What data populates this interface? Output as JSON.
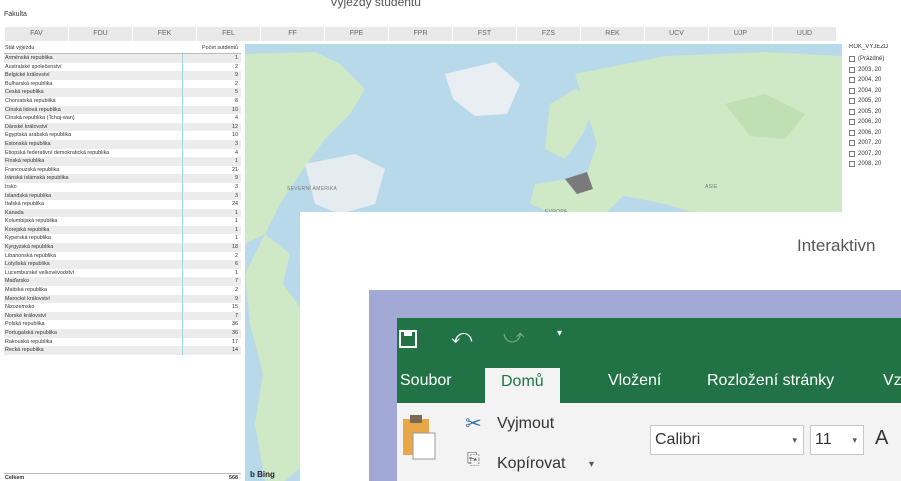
{
  "report": {
    "faculty_label": "Fakulta",
    "faculties": [
      "FAV",
      "FDU",
      "FEK",
      "FEL",
      "FF",
      "FPE",
      "FPR",
      "FST",
      "FZS",
      "REK",
      "UCV",
      "UJP",
      "UUD"
    ]
  },
  "table": {
    "col_country": "Stát výjezdu",
    "col_count": "Počet sutdentů",
    "rows": [
      {
        "name": "Arménská republika",
        "value": "1"
      },
      {
        "name": "Australské společenství",
        "value": "2"
      },
      {
        "name": "Belgické království",
        "value": "9"
      },
      {
        "name": "Bulharská republika",
        "value": "2"
      },
      {
        "name": "Česká republika",
        "value": "5"
      },
      {
        "name": "Chorvatská republika",
        "value": "8"
      },
      {
        "name": "Čínská lidová republika",
        "value": "10"
      },
      {
        "name": "Čínská republika (Tchaj-wan)",
        "value": "4"
      },
      {
        "name": "Dánské království",
        "value": "12"
      },
      {
        "name": "Egyptská arabská republika",
        "value": "10"
      },
      {
        "name": "Estonská republika",
        "value": "3"
      },
      {
        "name": "Etiopská federativní demokratická republika",
        "value": "4"
      },
      {
        "name": "Finská republika",
        "value": "1"
      },
      {
        "name": "Francouzská republika",
        "value": "21"
      },
      {
        "name": "Íránská islámská republika",
        "value": "9"
      },
      {
        "name": "Irsko",
        "value": "3"
      },
      {
        "name": "Islandská republika",
        "value": "3"
      },
      {
        "name": "Italská republika",
        "value": "24"
      },
      {
        "name": "Kanada",
        "value": "1"
      },
      {
        "name": "Kolumbijská republika",
        "value": "1"
      },
      {
        "name": "Korejská republika",
        "value": "1"
      },
      {
        "name": "Kyperská republika",
        "value": "1"
      },
      {
        "name": "Kyrgyzská republika",
        "value": "18"
      },
      {
        "name": "Libanonská republika",
        "value": "2"
      },
      {
        "name": "Lotyšská republika",
        "value": "6"
      },
      {
        "name": "Lucemburské velkovévodství",
        "value": "1"
      },
      {
        "name": "Maďarsko",
        "value": "7"
      },
      {
        "name": "Maltská republika",
        "value": "2"
      },
      {
        "name": "Marocké království",
        "value": "9"
      },
      {
        "name": "Nizozemsko",
        "value": "15"
      },
      {
        "name": "Norské království",
        "value": "7"
      },
      {
        "name": "Polská republika",
        "value": "36"
      },
      {
        "name": "Portugalská republika",
        "value": "36"
      },
      {
        "name": "Rakouská republika",
        "value": "17"
      },
      {
        "name": "Řecká republika",
        "value": "14"
      }
    ],
    "total_label": "Celkem",
    "total_value": "568"
  },
  "map": {
    "label_north_america": "SEVERNÍ AMERIKA",
    "label_europe": "EVROPA",
    "label_asia": "ASIE",
    "attribution": "Bing"
  },
  "slicer": {
    "title": "ROK_VYJEZD",
    "items": [
      "(Prázdné)",
      "2003, 20",
      "2004, 20",
      "2004, 20",
      "2005, 20",
      "2005, 20",
      "2006, 20",
      "2006, 20",
      "2007, 20",
      "2007, 20",
      "2008, 20"
    ]
  },
  "overlay": {
    "heading": "Interaktivn"
  },
  "excel": {
    "tabs": [
      "Soubor",
      "Domů",
      "Vložení",
      "Rozložení stránky",
      "Vzo"
    ],
    "cut_label": "Vyjmout",
    "copy_label": "Kopírovat",
    "font_name": "Calibri",
    "font_size": "11",
    "font_grow_label": "A"
  },
  "colors": {
    "excel_green": "#217346",
    "map_water": "#b8d9ea",
    "map_land": "#cfe8c5",
    "excel_backdrop": "#a2a9d5"
  }
}
